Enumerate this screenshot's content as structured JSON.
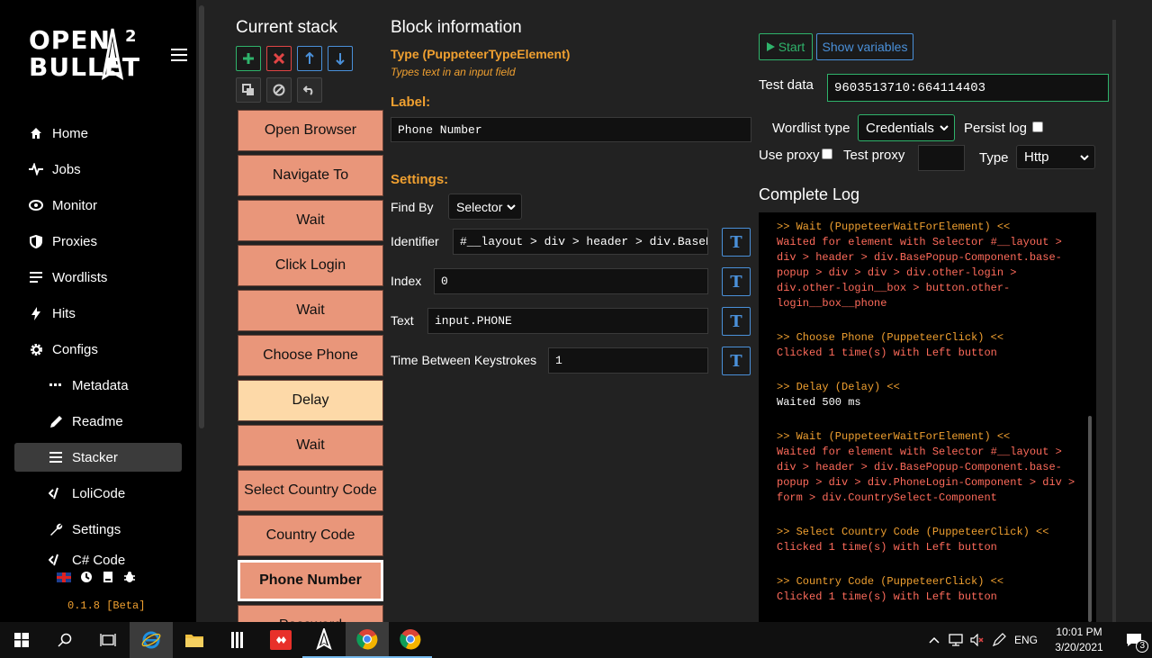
{
  "app": {
    "logo_line1": "OPEN",
    "logo_line2": "BULLET",
    "logo_sup": "2",
    "version": "0.1.8 [Beta]"
  },
  "sidebar": {
    "items": [
      {
        "label": "Home",
        "icon": "home-icon"
      },
      {
        "label": "Jobs",
        "icon": "pulse-icon"
      },
      {
        "label": "Monitor",
        "icon": "eye-icon"
      },
      {
        "label": "Proxies",
        "icon": "shield-icon"
      },
      {
        "label": "Wordlists",
        "icon": "list-icon"
      },
      {
        "label": "Hits",
        "icon": "bolt-icon"
      },
      {
        "label": "Configs",
        "icon": "gear-icon"
      },
      {
        "label": "Metadata",
        "icon": "dots-icon"
      },
      {
        "label": "Readme",
        "icon": "pencil-icon"
      },
      {
        "label": "Stacker",
        "icon": "bars-icon"
      },
      {
        "label": "LoliCode",
        "icon": "code-icon"
      },
      {
        "label": "Settings",
        "icon": "wrench-icon"
      },
      {
        "label": "C# Code",
        "icon": "code-icon"
      }
    ],
    "active": "Stacker"
  },
  "stack": {
    "title": "Current stack",
    "blocks": [
      "Open Browser",
      "Navigate To",
      "Wait",
      "Click Login",
      "Wait",
      "Choose Phone",
      "Delay",
      "Wait",
      "Select Country Code",
      "Country Code",
      "Phone Number",
      "Password"
    ],
    "selected_index": 10
  },
  "block_info": {
    "title": "Block information",
    "type": "Type (PuppeteerTypeElement)",
    "type_desc": "Types text in an input field",
    "label_heading": "Label:",
    "label_value": "Phone Number",
    "settings_heading": "Settings:",
    "find_by_label": "Find By",
    "find_by_value": "Selector",
    "identifier_label": "Identifier",
    "identifier_value": "#__layout > div > header > div.BasePopup-Component",
    "index_label": "Index",
    "index_value": "0",
    "text_label": "Text",
    "text_value": "input.PHONE",
    "keystroke_label": "Time Between Keystrokes",
    "keystroke_value": "1",
    "t_button": "T"
  },
  "debugger": {
    "start_label": "Start",
    "show_vars_label": "Show variables",
    "test_data_label": "Test data",
    "test_data_value": "9603513710:664114403",
    "wordlist_type_label": "Wordlist type",
    "wordlist_type_value": "Credentials",
    "persist_log_label": "Persist log",
    "use_proxy_label": "Use proxy",
    "test_proxy_label": "Test proxy",
    "test_proxy_value": "",
    "type_label": "Type",
    "type_value": "Http",
    "log_title": "Complete Log",
    "log": [
      {
        "head": ">> Wait (PuppeteerWaitForElement) <<",
        "body": "Waited for element with Selector #__layout > div > header > div.BasePopup-Component.base-popup > div > div > div.other-login > div.other-login__box > button.other-login__box__phone",
        "color": "red"
      },
      {
        "head": ">> Choose Phone (PuppeteerClick) <<",
        "body": "Clicked 1 time(s) with Left button",
        "color": "red"
      },
      {
        "head": ">> Delay (Delay) <<",
        "body": "Waited 500 ms",
        "color": "white"
      },
      {
        "head": ">> Wait (PuppeteerWaitForElement) <<",
        "body": "Waited for element with Selector #__layout > div > header > div.BasePopup-Component.base-popup > div > div.PhoneLogin-Component > div > form > div.CountrySelect-Component",
        "color": "red"
      },
      {
        "head": ">> Select Country Code (PuppeteerClick) <<",
        "body": "Clicked 1 time(s) with Left button",
        "color": "red"
      },
      {
        "head": ">> Country Code (PuppeteerClick) <<",
        "body": "Clicked 1 time(s) with Left button",
        "color": "red"
      }
    ]
  },
  "taskbar": {
    "lang": "ENG",
    "time": "10:01 PM",
    "date": "3/20/2021",
    "notif_count": "3"
  },
  "colors": {
    "block": "#e9967a",
    "block_delay": "#fdd9a8",
    "accent_orange": "#f0a030",
    "accent_green": "#2fb36b",
    "accent_blue": "#4a90d9"
  }
}
